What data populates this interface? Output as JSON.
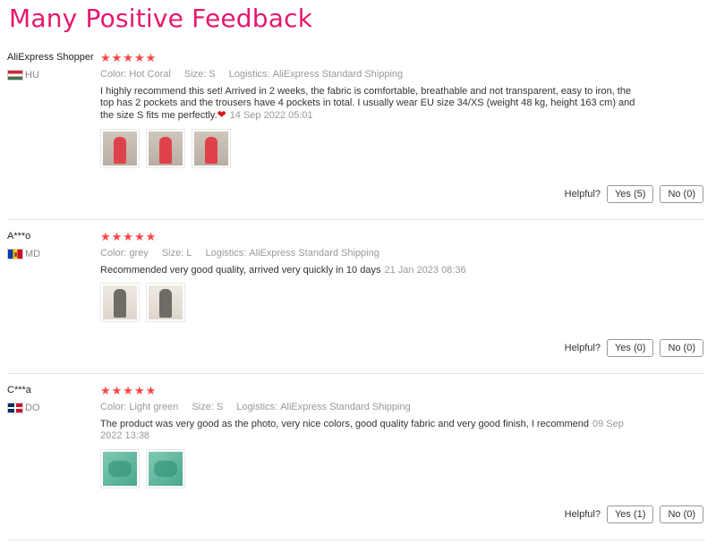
{
  "heading": "Many Positive Feedback",
  "labels": {
    "color": "Color:",
    "size": "Size:",
    "logistics": "Logistics:",
    "helpful": "Helpful?"
  },
  "reviews": [
    {
      "user": "AliExpress Shopper",
      "country": "HU",
      "flag_icon": "hungary-flag-icon",
      "stars": "★★★★★",
      "color": "Hot Coral",
      "size": "S",
      "logistics": "AliExpress Standard Shipping",
      "text": "I highly recommend this set! Arrived in 2 weeks, the fabric is comfortable, breathable and not transparent, easy to iron, the top has 2 pockets and the trousers have 4 pockets in total. I usually wear EU size 34/XS (weight 48 kg, height 163 cm) and the size S fits me perfectly.",
      "heart": "❤",
      "date": "14 Sep 2022 05:01",
      "photo_count": 3,
      "yes": "Yes (5)",
      "no": "No (0)"
    },
    {
      "user": "A***o",
      "country": "MD",
      "flag_icon": "moldova-flag-icon",
      "stars": "★★★★★",
      "color": "grey",
      "size": "L",
      "logistics": "AliExpress Standard Shipping",
      "text": "Recommended very good quality, arrived very quickly in 10 days",
      "heart": "",
      "date": "21 Jan 2023 08:36",
      "photo_count": 2,
      "yes": "Yes (0)",
      "no": "No (0)"
    },
    {
      "user": "C***a",
      "country": "DO",
      "flag_icon": "dominican-republic-flag-icon",
      "stars": "★★★★★",
      "color": "Light green",
      "size": "S",
      "logistics": "AliExpress Standard Shipping",
      "text": "The product was very good as the photo, very nice colors, good quality fabric and very good finish, I recommend",
      "heart": "",
      "date": "09 Sep 2022 13:38",
      "photo_count": 2,
      "yes": "Yes (1)",
      "no": "No (0)"
    }
  ],
  "colors": {
    "heading": "#e5186f",
    "stars": "#ff4444",
    "muted": "#999999"
  }
}
